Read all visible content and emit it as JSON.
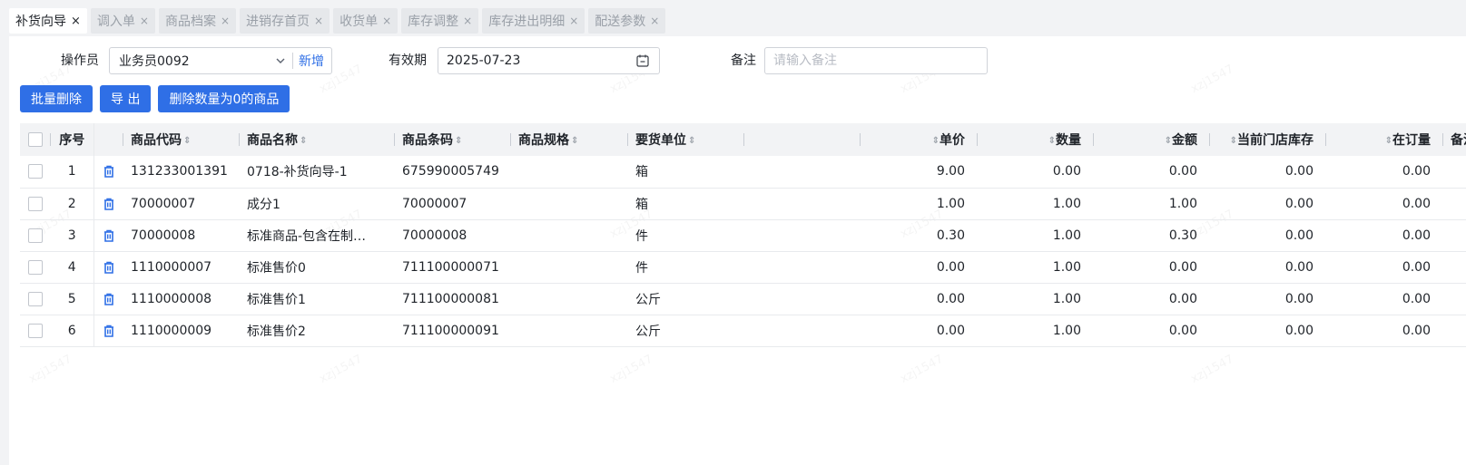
{
  "tabs": [
    {
      "label": "补货向导",
      "active": true
    },
    {
      "label": "调入单"
    },
    {
      "label": "商品档案"
    },
    {
      "label": "进销存首页"
    },
    {
      "label": "收货单"
    },
    {
      "label": "库存调整"
    },
    {
      "label": "库存进出明细"
    },
    {
      "label": "配送参数"
    }
  ],
  "tab_close": "×",
  "form": {
    "operator_label": "操作员",
    "operator_value": "业务员0092",
    "add_label": "新增",
    "valid_label": "有效期",
    "valid_value": "2025-07-23",
    "note_label": "备注",
    "note_placeholder": "请输入备注"
  },
  "actions": {
    "batch_delete": "批量删除",
    "export": "导 出",
    "delete_zero": "删除数量为0的商品"
  },
  "columns": {
    "index": "序号",
    "code": "商品代码",
    "name": "商品名称",
    "barcode": "商品条码",
    "spec": "商品规格",
    "unit": "要货单位",
    "price": "单价",
    "qty": "数量",
    "amount": "金额",
    "stock": "当前门店库存",
    "on_order": "在订量",
    "note": "备注"
  },
  "rows": [
    {
      "index": "1",
      "code": "131233001391",
      "name": "0718-补货向导-1",
      "barcode": "675990005749",
      "spec": "",
      "unit": "箱",
      "price": "9.00",
      "qty": "0.00",
      "amount": "0.00",
      "stock": "0.00",
      "on_order": "0.00",
      "note": ""
    },
    {
      "index": "2",
      "code": "70000007",
      "name": "成分1",
      "barcode": "70000007",
      "spec": "",
      "unit": "箱",
      "price": "1.00",
      "qty": "1.00",
      "amount": "1.00",
      "stock": "0.00",
      "on_order": "0.00",
      "note": ""
    },
    {
      "index": "3",
      "code": "70000008",
      "name": "标准商品-包含在制…",
      "barcode": "70000008",
      "spec": "",
      "unit": "件",
      "price": "0.30",
      "qty": "1.00",
      "amount": "0.30",
      "stock": "0.00",
      "on_order": "0.00",
      "note": ""
    },
    {
      "index": "4",
      "code": "1110000007",
      "name": "标准售价0",
      "barcode": "711100000071",
      "spec": "",
      "unit": "件",
      "price": "0.00",
      "qty": "1.00",
      "amount": "0.00",
      "stock": "0.00",
      "on_order": "0.00",
      "note": ""
    },
    {
      "index": "5",
      "code": "1110000008",
      "name": "标准售价1",
      "barcode": "711100000081",
      "spec": "",
      "unit": "公斤",
      "price": "0.00",
      "qty": "1.00",
      "amount": "0.00",
      "stock": "0.00",
      "on_order": "0.00",
      "note": ""
    },
    {
      "index": "6",
      "code": "1110000009",
      "name": "标准售价2",
      "barcode": "711100000091",
      "spec": "",
      "unit": "公斤",
      "price": "0.00",
      "qty": "1.00",
      "amount": "0.00",
      "stock": "0.00",
      "on_order": "0.00",
      "note": ""
    }
  ],
  "watermark": "xzj1547",
  "colors": {
    "primary": "#2f6fe6",
    "header_bg": "#f2f3f5"
  },
  "icons": {
    "row_delete": "trash-icon",
    "date": "calendar-icon",
    "select": "chevron-down-icon",
    "sort": "sort-icon"
  }
}
